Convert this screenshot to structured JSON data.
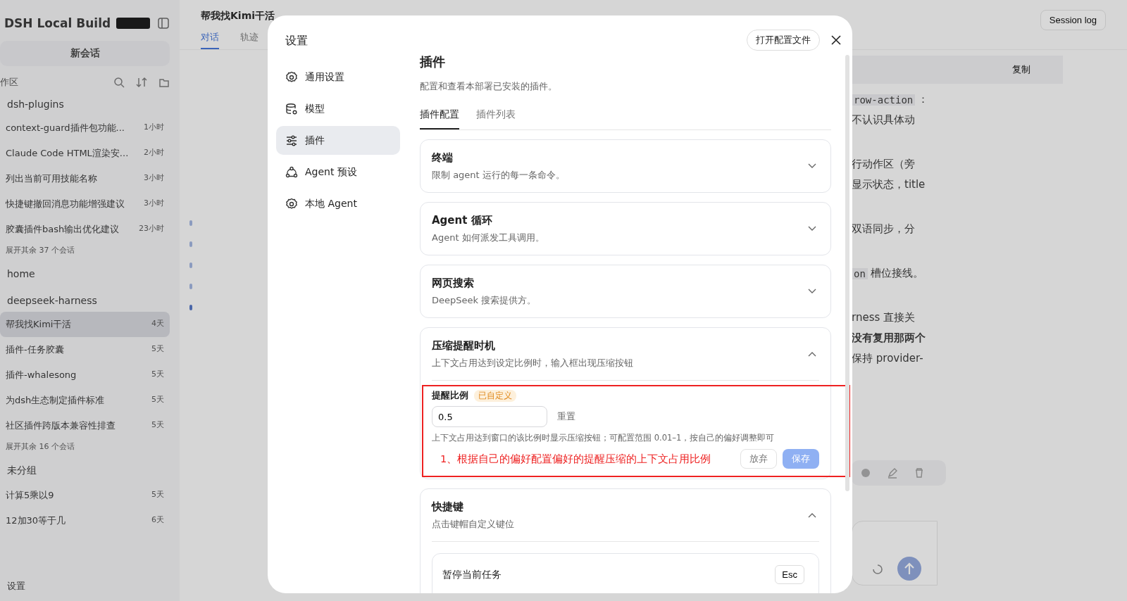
{
  "background": {
    "app_title": "DSH Local Build",
    "new_chat": "新会话",
    "section_label": "作区",
    "groups": [
      {
        "name": "dsh-plugins",
        "items": [
          {
            "title": "context-guard插件包功能...",
            "time": "1小时",
            "selected": false
          },
          {
            "title": "Claude Code HTML渲染安...",
            "time": "2小时",
            "selected": false
          },
          {
            "title": "列出当前可用技能名称",
            "time": "3小时",
            "selected": false
          },
          {
            "title": "快捷键撤回消息功能增强建议",
            "time": "3小时",
            "selected": false
          },
          {
            "title": "胶囊插件bash输出优化建议",
            "time": "23小时",
            "selected": false
          }
        ],
        "more": "展开其余 37 个会话"
      },
      {
        "name": "home"
      },
      {
        "name": "deepseek-harness",
        "items": [
          {
            "title": "帮我找Kimi干活",
            "time": "4天",
            "selected": true
          },
          {
            "title": "插件-任务胶囊",
            "time": "5天",
            "selected": false
          },
          {
            "title": "插件-whalesong",
            "time": "5天",
            "selected": false
          },
          {
            "title": "为dsh生态制定插件标准",
            "time": "5天",
            "selected": false
          },
          {
            "title": "社区插件跨版本兼容性排查",
            "time": "5天",
            "selected": false
          }
        ],
        "more": "展开其余 16 个会话"
      },
      {
        "name": "未分组",
        "items": [
          {
            "title": "计算5乘以9",
            "time": "5天",
            "selected": false
          },
          {
            "title": "12加30等于几",
            "time": "6天",
            "selected": false
          }
        ]
      }
    ],
    "footer": "设置",
    "chat_title": "帮我找Kimi干活",
    "chat_tabs": [
      {
        "label": "对话",
        "selected": true
      },
      {
        "label": "轨迹",
        "selected": false
      }
    ],
    "session_log": "Session log",
    "copy": "复制",
    "fragments": [
      [
        {
          "text": "row-action",
          "kind": "code"
        },
        {
          "text": "：",
          "kind": "text"
        }
      ],
      [
        {
          "text": "不认识具体动",
          "kind": "text"
        }
      ],
      [
        {
          "text": "行动作区（旁",
          "kind": "text"
        }
      ],
      [
        {
          "text": "显示状态，title",
          "kind": "text"
        }
      ],
      [
        {
          "text": "双语同步，分",
          "kind": "text"
        }
      ],
      [
        {
          "text": "on",
          "kind": "code"
        },
        {
          "text": "槽位接线。",
          "kind": "text"
        }
      ],
      [
        {
          "text": "rness 直接关",
          "kind": "text"
        }
      ],
      [
        {
          "text": "没有复用那两个",
          "kind": "bold"
        }
      ],
      [
        {
          "text": "保持 provider-",
          "kind": "text"
        }
      ]
    ]
  },
  "dialog": {
    "title": "设置",
    "open_config_button": "打开配置文件",
    "nav": [
      {
        "label": "通用设置",
        "selected": false
      },
      {
        "label": "模型",
        "selected": false
      },
      {
        "label": "插件",
        "selected": true
      },
      {
        "label": "Agent 预设",
        "selected": false
      },
      {
        "label": "本地 Agent",
        "selected": false
      }
    ],
    "page": {
      "title": "插件",
      "subtitle": "配置和查看本部署已安装的插件。",
      "tabs": [
        {
          "label": "插件配置",
          "selected": true
        },
        {
          "label": "插件列表",
          "selected": false
        }
      ],
      "sections": [
        {
          "title": "终端",
          "description": "限制 agent 运行的每一条命令。",
          "expanded": false
        },
        {
          "title": "Agent 循环",
          "description": "Agent 如何派发工具调用。",
          "expanded": false
        },
        {
          "title": "网页搜索",
          "description": "DeepSeek 搜索提供方。",
          "expanded": false
        },
        {
          "title": "压缩提醒时机",
          "description": "上下文占用达到设定比例时，输入框出现压缩按钮",
          "expanded": true,
          "kind": "setting",
          "setting": {
            "label": "提醒比例",
            "badge": "已自定义",
            "value": "0.5",
            "reset": "重置",
            "hint": "上下文占用达到窗口的该比例时显示压缩按钮；可配置范围 0.01–1，按自己的偏好调整即可",
            "annotation": "1、根据自己的偏好配置偏好的提醒压缩的上下文占用比例",
            "discard": "放弃",
            "save": "保存",
            "save_enabled": false
          }
        },
        {
          "title": "快捷键",
          "description": "点击键帽自定义键位",
          "expanded": true,
          "kind": "shortcuts",
          "shortcuts": [
            {
              "label": "暂停当前任务",
              "key": "Esc"
            }
          ]
        }
      ]
    }
  }
}
